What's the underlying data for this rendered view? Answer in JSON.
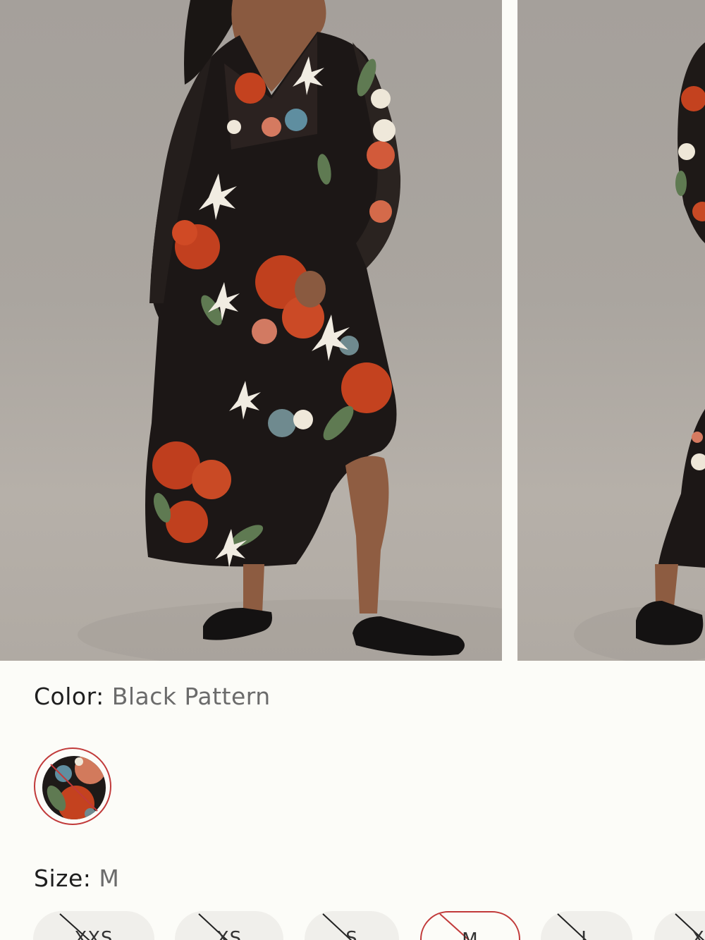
{
  "gallery": {
    "images": [
      {
        "alt": "model-front"
      },
      {
        "alt": "model-side"
      }
    ]
  },
  "color": {
    "label": "Color:",
    "value": "Black Pattern",
    "swatch_unavailable": true
  },
  "size": {
    "label": "Size:",
    "value": "M",
    "options": [
      {
        "label": "XXS",
        "available": false,
        "selected": false
      },
      {
        "label": "XS",
        "available": false,
        "selected": false
      },
      {
        "label": "S",
        "available": false,
        "selected": false
      },
      {
        "label": "M",
        "available": false,
        "selected": true
      },
      {
        "label": "L",
        "available": false,
        "selected": false
      },
      {
        "label": "XL",
        "available": false,
        "selected": false
      }
    ]
  },
  "colors": {
    "background": "#fcfcf8",
    "chip_bg": "#f0efeb",
    "accent_red": "#c13a3a"
  }
}
